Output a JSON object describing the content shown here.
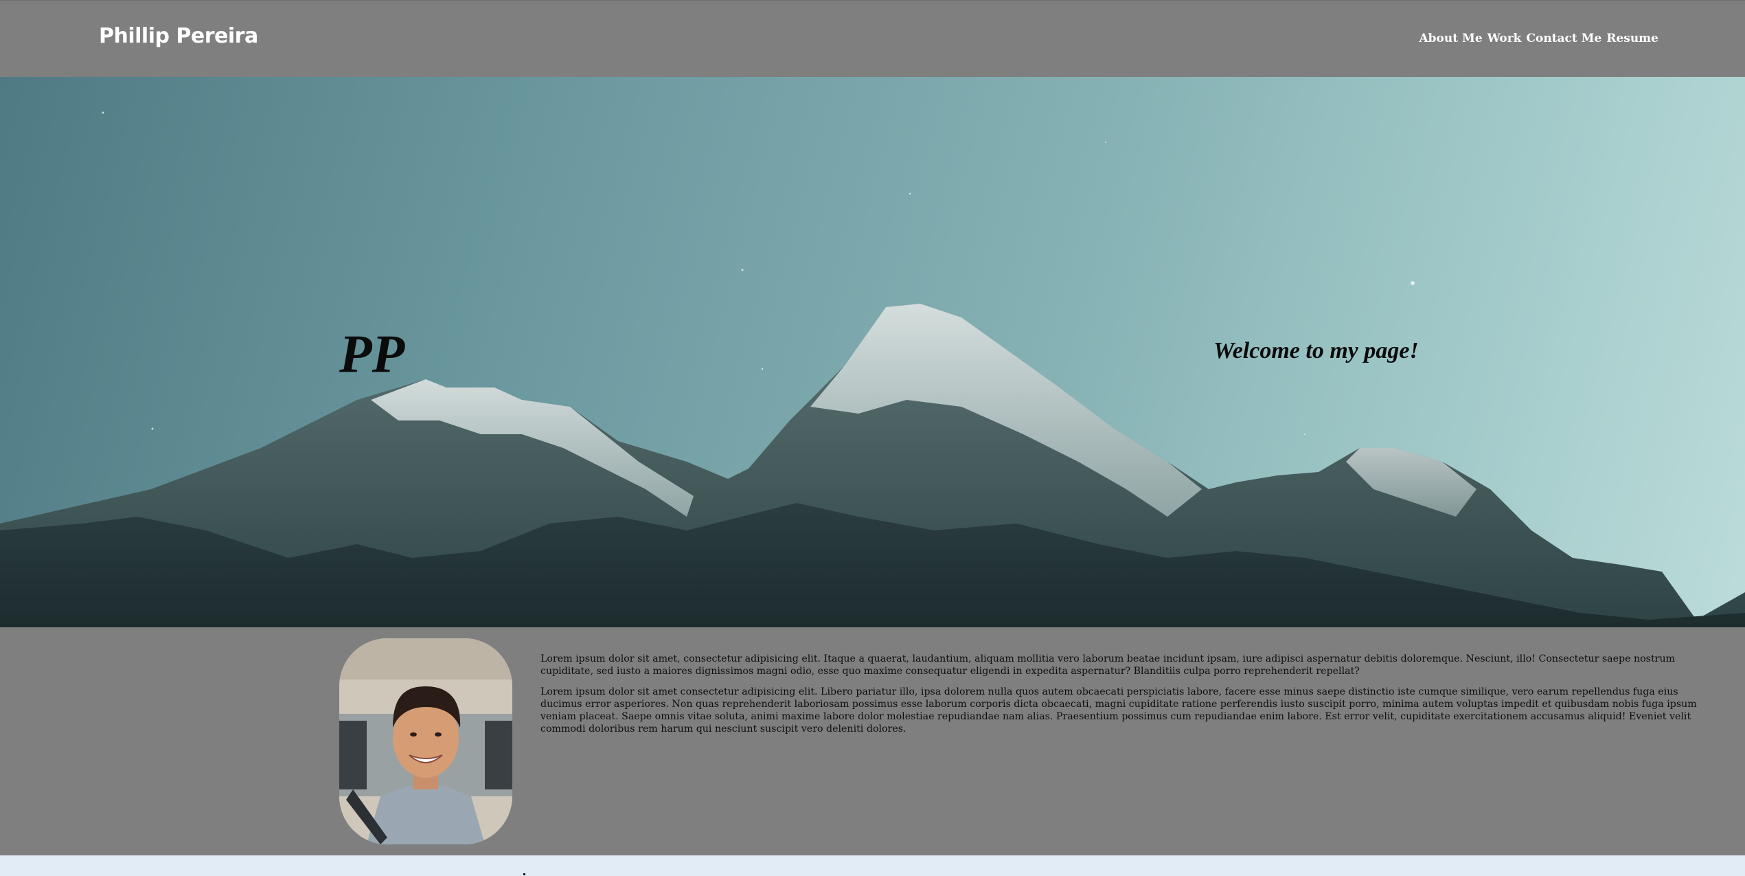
{
  "header": {
    "brand": "Phillip Pereira",
    "nav": [
      "About Me",
      "Work",
      "Contact Me",
      "Resume"
    ]
  },
  "hero": {
    "initials": "PP",
    "welcome": "Welcome to my page!"
  },
  "about": {
    "paragraphs": [
      "Lorem ipsum dolor sit amet, consectetur adipisicing elit. Itaque a quaerat, laudantium, aliquam mollitia vero laborum beatae incidunt ipsam, iure adipisci aspernatur debitis doloremque. Nesciunt, illo! Consectetur saepe nostrum cupiditate, sed iusto a maiores dignissimos magni odio, esse quo maxime consequatur eligendi in expedita aspernatur? Blanditiis culpa porro reprehenderit repellat?",
      "Lorem ipsum dolor sit amet consectetur adipisicing elit. Libero pariatur illo, ipsa dolorem nulla quos autem obcaecati perspiciatis labore, facere esse minus saepe distinctio iste cumque similique, vero earum repellendus fuga eius ducimus error asperiores. Non quas reprehenderit laboriosam possimus esse laborum corporis dicta obcaecati, magni cupiditate ratione perferendis iusto suscipit porro, minima autem voluptas impedit et quibusdam nobis fuga ipsum veniam placeat. Saepe omnis vitae soluta, animi maxime labore dolor molestiae repudiandae nam alias. Praesentium possimus cum repudiandae enim labore. Est error velit, cupiditate exercitationem accusamus aliquid! Eveniet velit commodi doloribus rem harum qui nesciunt suscipit vero deleniti dolores."
    ]
  },
  "colors": {
    "header_bg": "#7f7f7f",
    "section_bg": "#7f7f7f",
    "footer_bg": "#e2ecf6",
    "text_light": "#ffffff",
    "text_dark": "#0b0b0b"
  }
}
